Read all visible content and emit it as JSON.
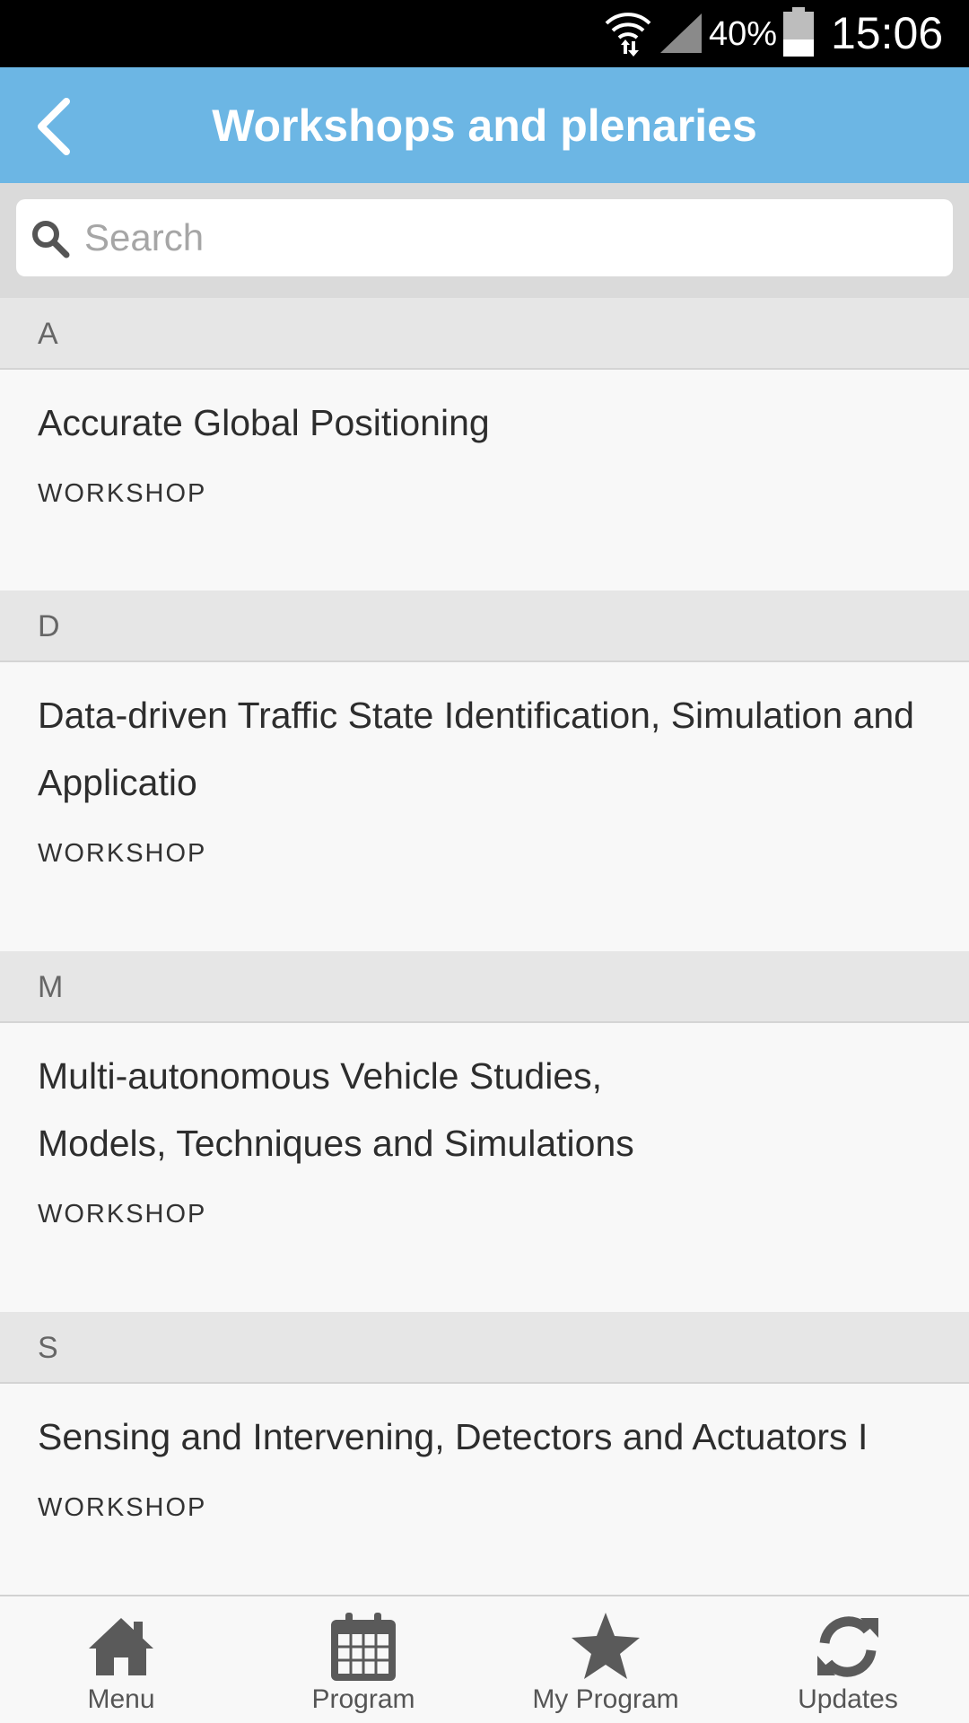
{
  "status_bar": {
    "battery_percent": "40%",
    "time": "15:06",
    "icons": [
      "wifi-icon",
      "signal-icon",
      "battery-icon"
    ]
  },
  "app_bar": {
    "title": "Workshops and plenaries",
    "back_icon": "chevron-left-icon"
  },
  "search": {
    "placeholder": "Search",
    "value": "",
    "icon": "search-icon"
  },
  "sections": [
    {
      "letter": "A",
      "items": [
        {
          "title": "Accurate Global Positioning",
          "type": "WORKSHOP"
        }
      ]
    },
    {
      "letter": "D",
      "items": [
        {
          "title": "Data-driven Traffic State Identification, Simulation and Applicatio",
          "type": "WORKSHOP"
        }
      ]
    },
    {
      "letter": "M",
      "items": [
        {
          "title": "Multi-autonomous Vehicle Studies, Models, Techniques and Simulations",
          "type": "WORKSHOP"
        }
      ]
    },
    {
      "letter": "S",
      "items": [
        {
          "title": "Sensing and Intervening, Detectors and Actuators I",
          "type": "WORKSHOP"
        }
      ]
    }
  ],
  "bottom_nav": [
    {
      "label": "Menu",
      "icon": "home-icon"
    },
    {
      "label": "Program",
      "icon": "calendar-icon"
    },
    {
      "label": "My Program",
      "icon": "star-icon"
    },
    {
      "label": "Updates",
      "icon": "refresh-icon"
    }
  ],
  "colors": {
    "app_bar": "#6cb6e4",
    "section_header": "#e6e6e6",
    "list_background": "#f8f8f8",
    "nav_icon": "#5a5a5a"
  }
}
